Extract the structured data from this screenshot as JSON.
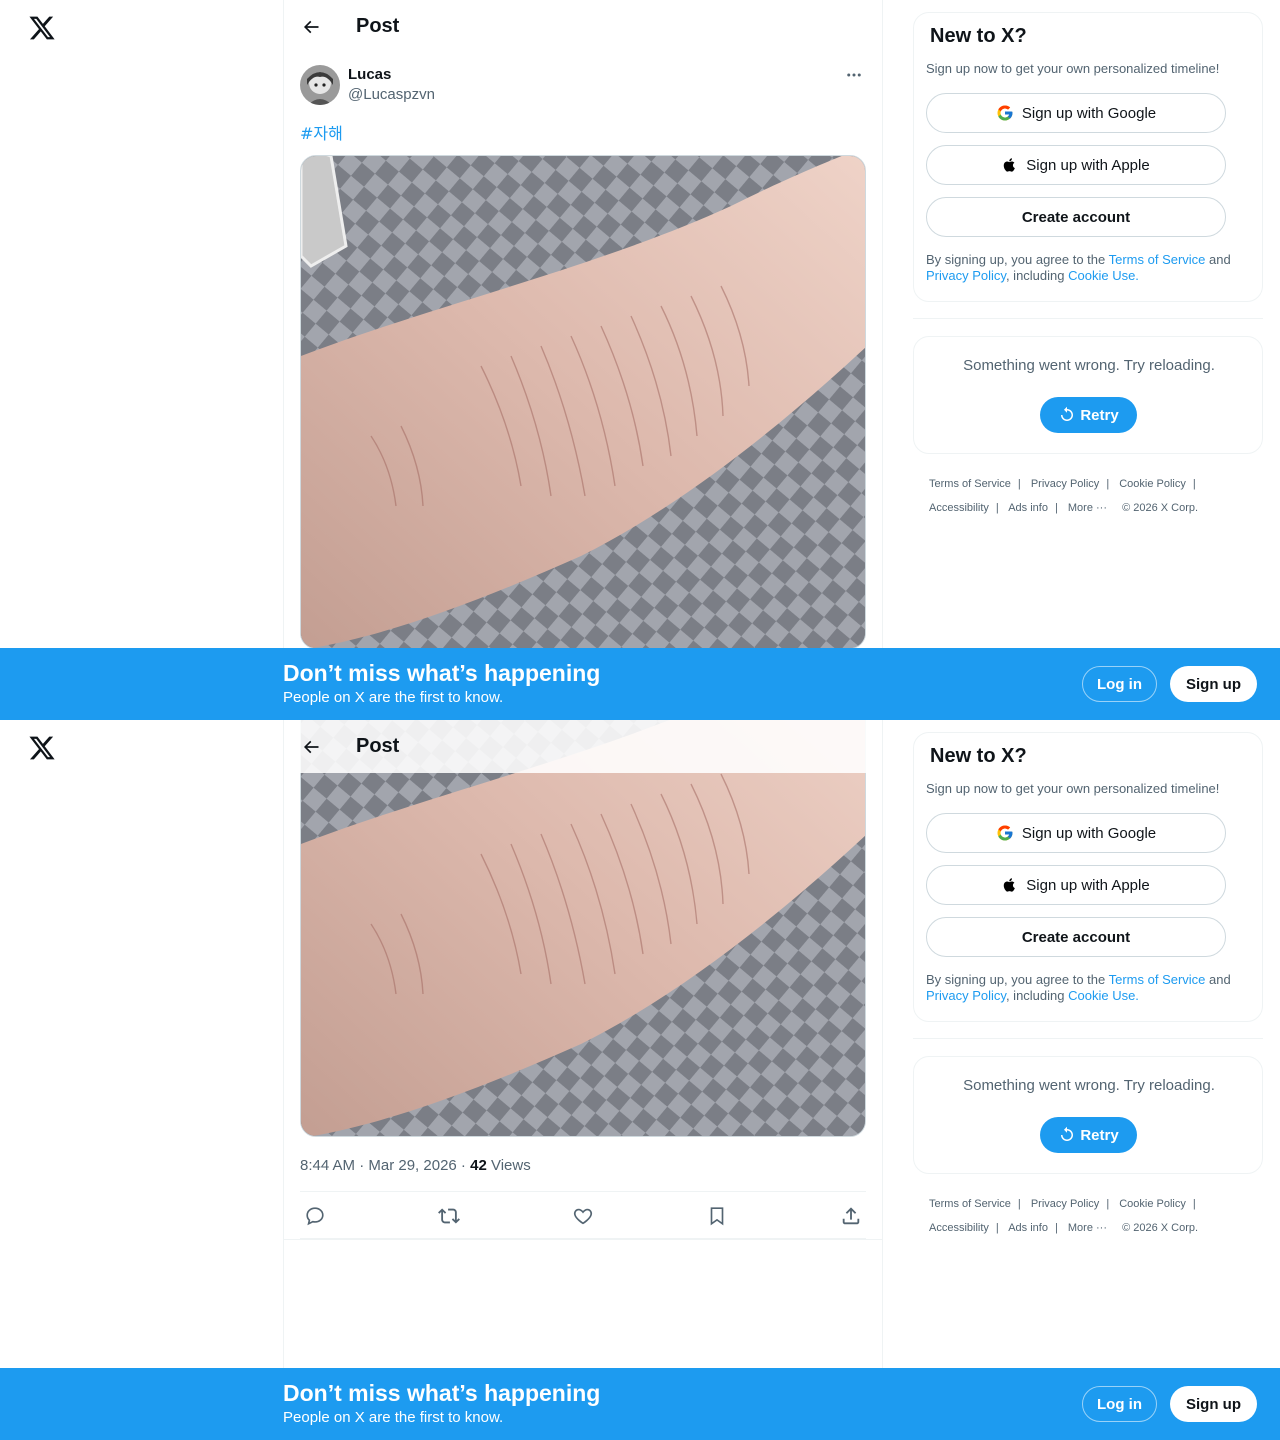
{
  "topbar": {
    "title": "Post"
  },
  "author": {
    "name": "Lucas",
    "handle": "@Lucaspzvn"
  },
  "post": {
    "hashtag": "#자해",
    "time": "8:44 AM · Mar 29, 2026",
    "separator": " · ",
    "views_count": "42",
    "views_label": "Views"
  },
  "actions": [
    "reply-icon",
    "repost-icon",
    "like-icon",
    "bookmark-icon",
    "share-icon"
  ],
  "signup_card": {
    "title": "New to X?",
    "subtitle": "Sign up now to get your own personalized timeline!",
    "google_label": "Sign up with Google",
    "apple_label": "Sign up with Apple",
    "create_label": "Create account",
    "legal_prefix": "By signing up, you agree to the ",
    "terms_link": "Terms of Service",
    "legal_and": " and",
    "privacy_link": "Privacy Policy",
    "legal_including": ", including ",
    "cookie_link": "Cookie Use."
  },
  "error_card": {
    "message": "Something went wrong. Try reloading.",
    "retry_label": "Retry"
  },
  "footer": {
    "terms": "Terms of Service",
    "privacy": "Privacy Policy",
    "cookie": "Cookie Policy",
    "accessibility": "Accessibility",
    "ads": "Ads info",
    "more": "More",
    "copyright": "© 2026 X Corp.",
    "sep": "|"
  },
  "banner": {
    "title": "Don’t miss what’s happening",
    "subtitle": "People on X are the first to know.",
    "login_label": "Log in",
    "signup_label": "Sign up"
  },
  "colors": {
    "accent": "#1d9bf0",
    "text": "#0f1419",
    "secondary_text": "#536471",
    "border": "#eff3f4"
  }
}
